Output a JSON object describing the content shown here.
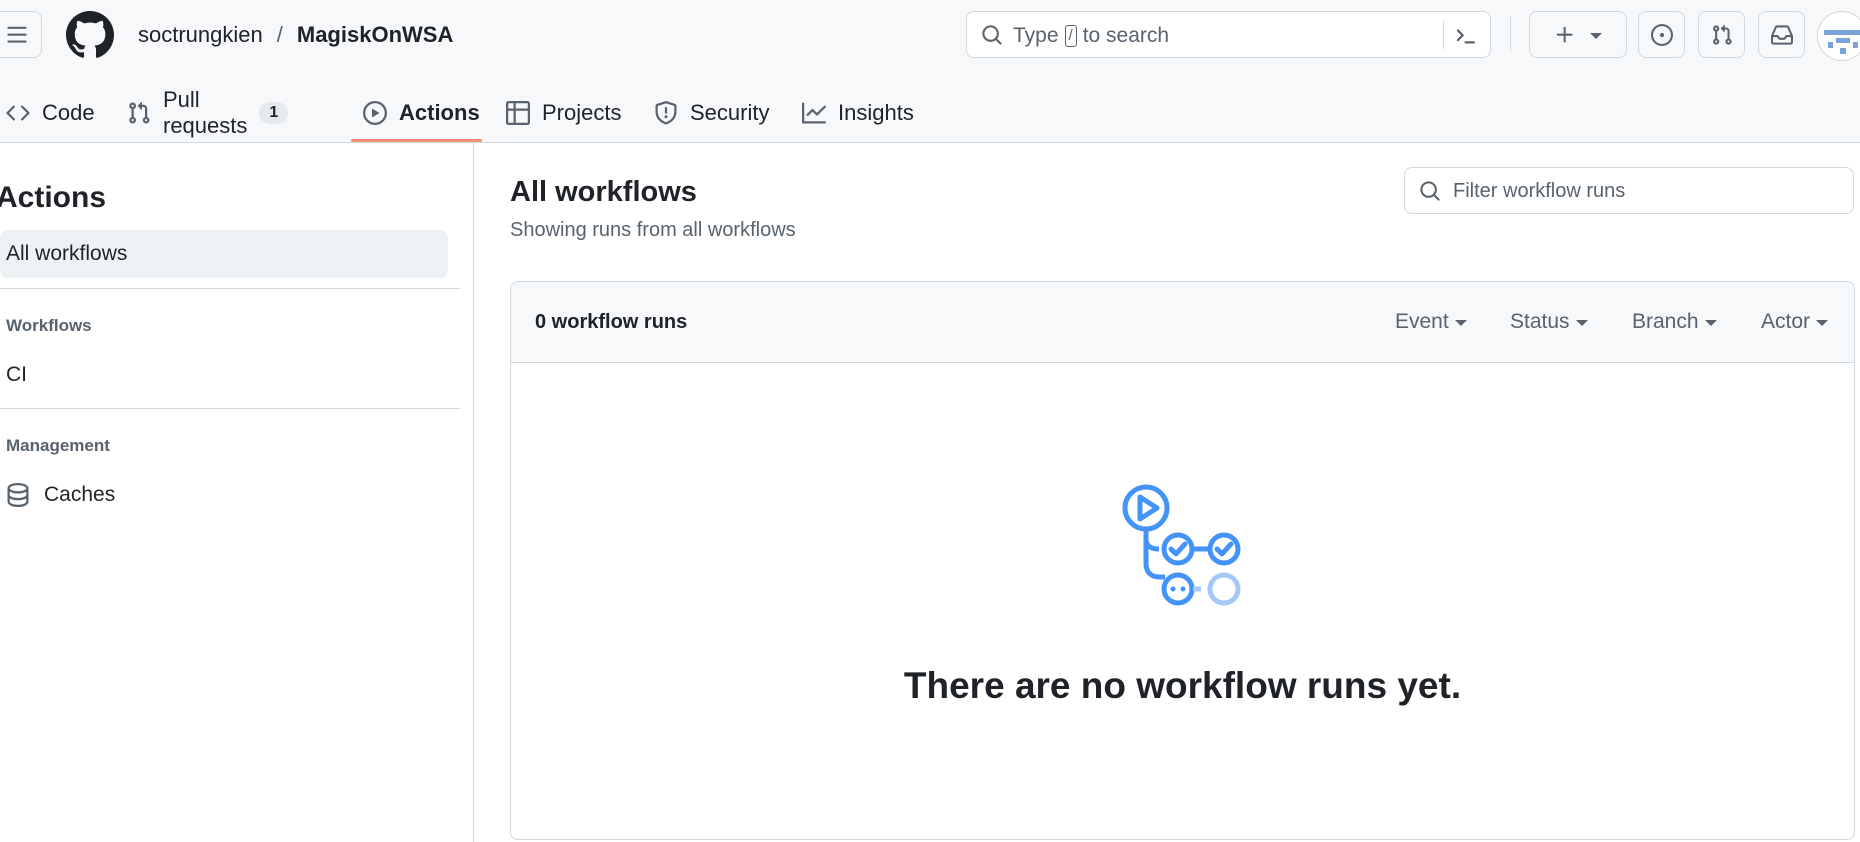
{
  "header": {
    "owner": "soctrungkien",
    "separator": "/",
    "repo": "MagiskOnWSA",
    "search": {
      "prefix": "Type",
      "key": "/",
      "suffix": "to search"
    }
  },
  "tabs": [
    {
      "label": "Code",
      "icon": "code-icon"
    },
    {
      "label": "Pull requests",
      "icon": "git-pull-request-icon",
      "count": "1"
    },
    {
      "label": "Actions",
      "icon": "play-icon",
      "active": true
    },
    {
      "label": "Projects",
      "icon": "table-icon"
    },
    {
      "label": "Security",
      "icon": "shield-icon"
    },
    {
      "label": "Insights",
      "icon": "graph-icon"
    }
  ],
  "sidebar": {
    "title": "Actions",
    "all_workflows": "All workflows",
    "workflows_heading": "Workflows",
    "workflow_items": [
      "CI"
    ],
    "management_heading": "Management",
    "management_items": [
      {
        "label": "Caches",
        "icon": "database-icon"
      }
    ]
  },
  "main": {
    "title": "All workflows",
    "subtitle": "Showing runs from all workflows",
    "filter_placeholder": "Filter workflow runs",
    "run_count": "0 workflow runs",
    "filters": [
      "Event",
      "Status",
      "Branch",
      "Actor"
    ],
    "empty_message": "There are no workflow runs yet."
  },
  "colors": {
    "accent_underline": "#fd8c73",
    "illustration_blue": "#4493f8",
    "muted_text": "#59636e"
  }
}
